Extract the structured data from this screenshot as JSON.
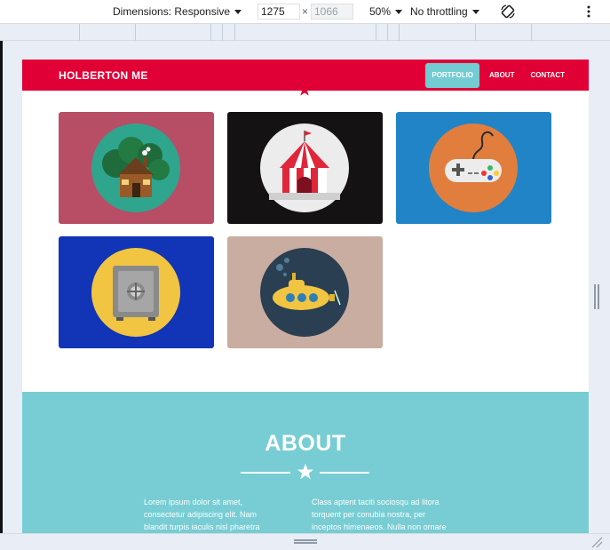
{
  "devtools": {
    "dimensions_label": "Dimensions: Responsive",
    "width_value": "1275",
    "times": "×",
    "height_value": "1066",
    "zoom_label": "50%",
    "throttle_label": "No throttling",
    "rotate_icon": "rotate-icon",
    "more_icon": "more-vertical-icon"
  },
  "site": {
    "brand": "HOLBERTON ME",
    "nav": [
      {
        "label": "PORTFOLIO",
        "active": true
      },
      {
        "label": "ABOUT",
        "active": false
      },
      {
        "label": "CONTACT",
        "active": false
      }
    ],
    "portfolio": [
      {
        "name": "cabin",
        "bg": "#b84d66",
        "circle": "#2fa58e"
      },
      {
        "name": "circus-tent",
        "bg": "#141212",
        "circle": "#ececec"
      },
      {
        "name": "game-controller",
        "bg": "#2184c6",
        "circle": "#e17e3e"
      },
      {
        "name": "safe",
        "bg": "#1234b6",
        "circle": "#f1c541"
      },
      {
        "name": "submarine",
        "bg": "#c9ada1",
        "circle": "#2a3f52"
      }
    ],
    "about": {
      "title": "ABOUT",
      "col1": "Lorem ipsum dolor sit amet, consectetur adipiscing elit. Nam blandit turpis iaculis nisl pharetra auctor. Phasellus mattis",
      "col2": "Class aptent taciti sociosqu ad litora torquent per conubia nostra, per inceptos himenaeos. Nulla non ornare"
    }
  },
  "colors": {
    "navbar": "#e10036",
    "accent": "#73ccd3",
    "about_bg": "#77cdd3"
  }
}
